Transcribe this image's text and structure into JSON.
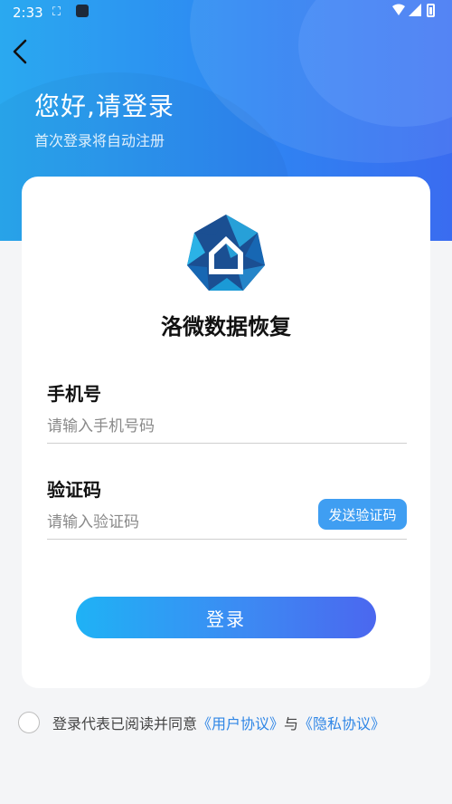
{
  "status_bar": {
    "time": "2:33"
  },
  "header": {
    "title": "您好,请登录",
    "subtitle": "首次登录将自动注册"
  },
  "app": {
    "name": "洛微数据恢复"
  },
  "phone": {
    "label": "手机号",
    "placeholder": "请输入手机号码"
  },
  "code": {
    "label": "验证码",
    "placeholder": "请输入验证码",
    "send_label": "发送验证码"
  },
  "login": {
    "label": "登录"
  },
  "agreement": {
    "prefix": "登录代表已阅读并同意",
    "user_agreement": "《用户协议》",
    "connector": "与",
    "privacy_agreement": "《隐私协议》"
  },
  "colors": {
    "primary": "#2e86f2",
    "send_button": "#3f9ef2",
    "link": "#2f86e6"
  }
}
